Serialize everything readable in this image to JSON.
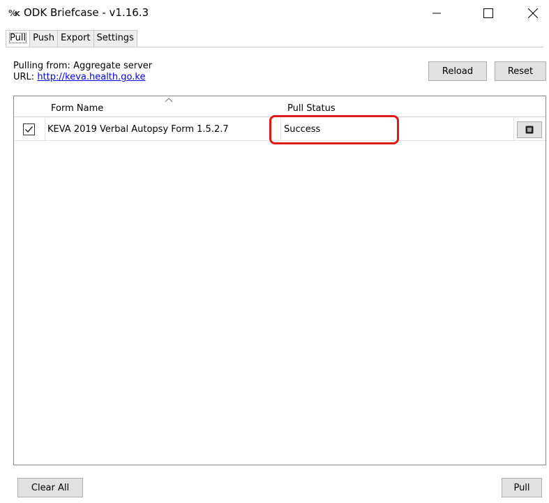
{
  "window": {
    "title": "ODK Briefcase - v1.16.3",
    "app_icon": "odk-briefcase-icon",
    "controls": [
      "minimize-icon",
      "maximize-icon",
      "close-icon"
    ]
  },
  "tabs": [
    {
      "label": "Pull",
      "active": true
    },
    {
      "label": "Push",
      "active": false
    },
    {
      "label": "Export",
      "active": false
    },
    {
      "label": "Settings",
      "active": false
    }
  ],
  "source": {
    "pulling_from": "Pulling from: Aggregate server",
    "url_label": "URL:",
    "url": "http://keva.health.go.ke"
  },
  "actions": {
    "reload_label": "Reload",
    "reset_label": "Reset",
    "clear_all_label": "Clear All",
    "pull_label": "Pull"
  },
  "table": {
    "columns": [
      "Form Name",
      "Pull Status"
    ],
    "sort_indicator": "sort-ascending-icon",
    "rows": [
      {
        "selected": true,
        "form_name": "KEVA 2019 Verbal Autopsy Form 1.5.2.7",
        "pull_status": "Success",
        "detail_icon": "details-icon"
      }
    ]
  },
  "annotation": {
    "shape": "rounded-rectangle",
    "color": "#e11818",
    "target": "pull-status-cell"
  }
}
